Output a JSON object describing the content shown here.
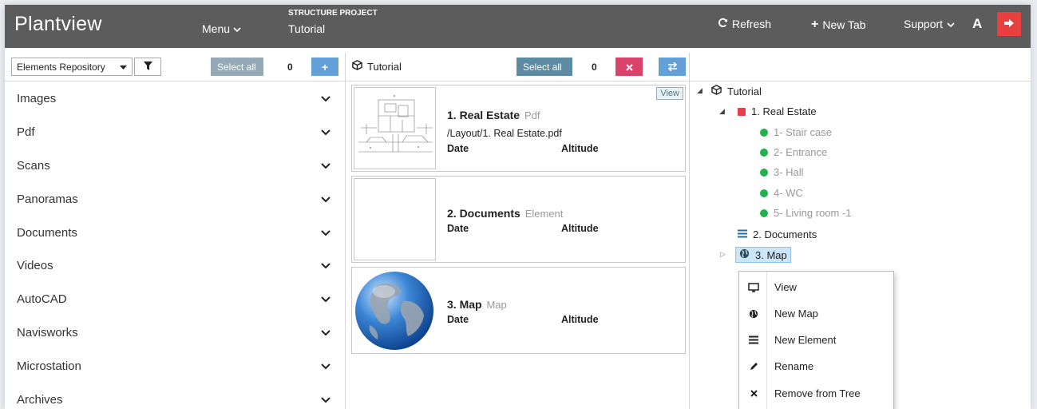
{
  "header": {
    "brand": "Plantview",
    "menu_label": "Menu",
    "project_label": "STRUCTURE PROJECT",
    "project_name": "Tutorial",
    "refresh_label": "Refresh",
    "newtab_label": "New Tab",
    "support_label": "Support",
    "font_label": "A",
    "logout_color": "#e8403f"
  },
  "left_toolbar": {
    "repository_label": "Elements Repository",
    "select_all": "Select all",
    "count": "0",
    "add_label": "+"
  },
  "categories": [
    {
      "label": "Images"
    },
    {
      "label": "Pdf"
    },
    {
      "label": "Scans"
    },
    {
      "label": "Panoramas"
    },
    {
      "label": "Documents"
    },
    {
      "label": "Videos"
    },
    {
      "label": "AutoCAD"
    },
    {
      "label": "Navisworks"
    },
    {
      "label": "Microstation"
    },
    {
      "label": "Archives"
    }
  ],
  "middle_toolbar": {
    "title": "Tutorial",
    "select_all": "Select all",
    "count": "0"
  },
  "cards": [
    {
      "title": "1. Real Estate",
      "type": "Pdf",
      "path": "/Layout/1. Real Estate.pdf",
      "date_label": "Date",
      "altitude_label": "Altitude",
      "view_label": "View"
    },
    {
      "title": "2. Documents",
      "type": "Element",
      "date_label": "Date",
      "altitude_label": "Altitude"
    },
    {
      "title": "3. Map",
      "type": "Map",
      "date_label": "Date",
      "altitude_label": "Altitude"
    }
  ],
  "tree": {
    "root": "Tutorial",
    "real_estate": "1. Real Estate",
    "children": [
      {
        "label": "1- Stair case"
      },
      {
        "label": "2- Entrance"
      },
      {
        "label": "3- Hall"
      },
      {
        "label": "4- WC"
      },
      {
        "label": "5- Living room -1"
      }
    ],
    "documents": "2. Documents",
    "map": "3. Map"
  },
  "context_menu": [
    {
      "label": "View",
      "icon": "monitor-icon"
    },
    {
      "label": "New Map",
      "icon": "globe-icon"
    },
    {
      "label": "New Element",
      "icon": "lines-icon"
    },
    {
      "label": "Rename",
      "icon": "pencil-icon"
    },
    {
      "label": "Remove from Tree",
      "icon": "x-icon"
    }
  ]
}
